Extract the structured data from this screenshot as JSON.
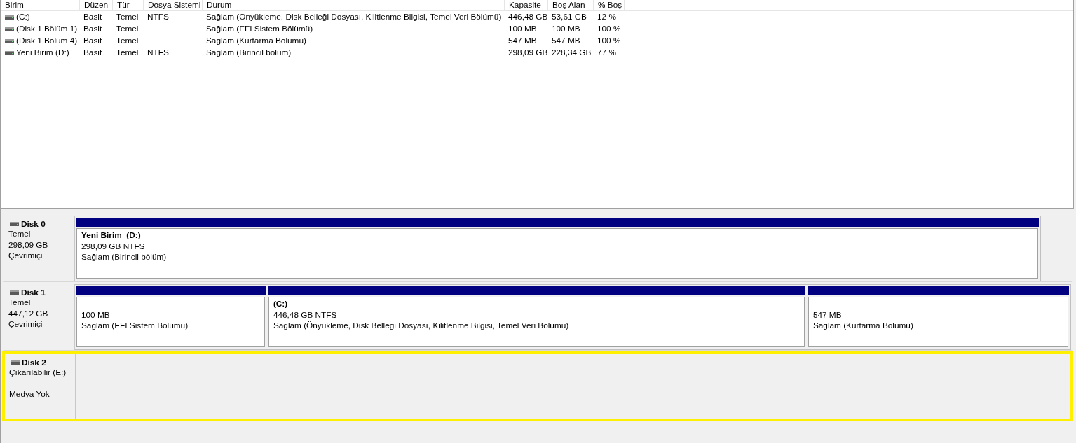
{
  "volume_list": {
    "columns": [
      "Birim",
      "Düzen",
      "Tür",
      "Dosya Sistemi",
      "Durum",
      "Kapasite",
      "Boş Alan",
      "% Boş"
    ],
    "rows": [
      {
        "volume": "(C:)",
        "layout": "Basit",
        "type": "Temel",
        "file_system": "NTFS",
        "status": "Sağlam (Önyükleme, Disk Belleği Dosyası, Kilitlenme Bilgisi, Temel Veri Bölümü)",
        "capacity": "446,48 GB",
        "free_space": "53,61 GB",
        "percent_free": "12 %"
      },
      {
        "volume": "(Disk 1 Bölüm 1)",
        "layout": "Basit",
        "type": "Temel",
        "status": "Sağlam (EFI Sistem Bölümü)",
        "capacity": "100 MB",
        "free_space": "100 MB",
        "percent_free": "100 %"
      },
      {
        "volume": "(Disk 1 Bölüm 4)",
        "layout": "Basit",
        "type": "Temel",
        "status": "Sağlam (Kurtarma Bölümü)",
        "capacity": "547 MB",
        "free_space": "547 MB",
        "percent_free": "100 %"
      },
      {
        "volume": "Yeni Birim (D:)",
        "layout": "Basit",
        "type": "Temel",
        "file_system": "NTFS",
        "status": "Sağlam (Birincil bölüm)",
        "capacity": "298,09 GB",
        "free_space": "228,34 GB",
        "percent_free": "77 %"
      }
    ]
  },
  "disks": [
    {
      "name": "Disk 0",
      "type": "Temel",
      "size": "298,09 GB",
      "status": "Çevrimiçi",
      "selected": false,
      "partitions": [
        {
          "label": "Yeni Birim  (D:)",
          "size": "298,09 GB NTFS",
          "status": "Sağlam (Birincil bölüm)"
        }
      ]
    },
    {
      "name": "Disk 1",
      "type": "Temel",
      "size": "447,12 GB",
      "status": "Çevrimiçi",
      "selected": false,
      "partitions": [
        {
          "size": "100 MB",
          "status": "Sağlam (EFI Sistem Bölümü)"
        },
        {
          "label": "(C:)",
          "size": "446,48 GB NTFS",
          "status": "Sağlam (Önyükleme, Disk Belleği Dosyası, Kilitlenme Bilgisi, Temel Veri Bölümü)"
        },
        {
          "size": "547 MB",
          "status": "Sağlam (Kurtarma Bölümü)"
        }
      ]
    },
    {
      "name": "Disk 2",
      "type": "Çıkarılabilir (E:)",
      "status": "Medya Yok",
      "selected": true
    }
  ]
}
